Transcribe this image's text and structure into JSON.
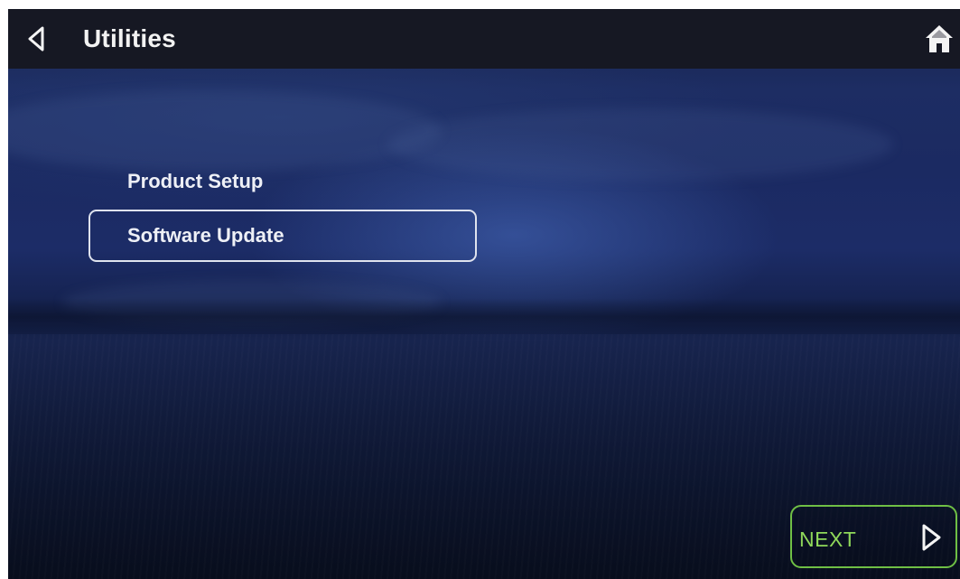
{
  "header": {
    "title": "Utilities",
    "back_icon": "back-triangle-icon",
    "home_icon": "home-icon"
  },
  "menu": {
    "items": [
      {
        "label": "Product Setup",
        "selected": false
      },
      {
        "label": "Software Update",
        "selected": true
      }
    ]
  },
  "footer": {
    "next_label": "NEXT",
    "next_icon": "next-triangle-icon"
  },
  "colors": {
    "header_bg": "#161823",
    "text": "#eef0f6",
    "selection_border": "#dfe3ee",
    "next_accent": "#8fd85a",
    "next_border": "#6fbf45"
  }
}
